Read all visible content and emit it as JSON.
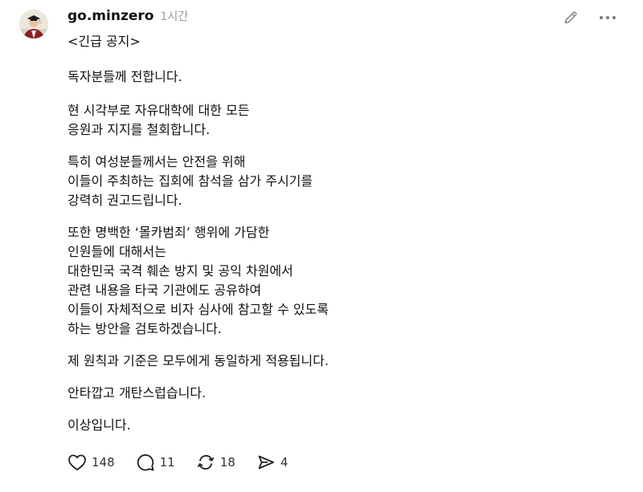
{
  "post": {
    "username": "go.minzero",
    "timestamp": "1시간",
    "paragraphs": [
      "<긴급 공지>",
      "독자분들께 전합니다.",
      "현 시각부로 자유대학에 대한 모든\n응원과 지지를 철회합니다.",
      "특히 여성분들께서는 안전을 위해\n이들이 주최하는 집회에 참석을 삼가 주시기를\n강력히 권고드립니다.",
      "또한 명백한 ‘몰카범죄’ 행위에 가담한\n인원들에 대해서는\n대한민국 국격 훼손 방지 및 공익 차원에서\n관련 내용을 타국 기관에도 공유하여\n이들이 자체적으로 비자 심사에 참고할 수 있도록\n하는 방안을 검토하겠습니다.",
      "제 원칙과 기준은 모두에게 동일하게 적용됩니다.",
      "안타깝고 개탄스럽습니다.",
      "이상입니다."
    ]
  },
  "actions": {
    "likes": "148",
    "comments": "11",
    "reposts": "18",
    "shares": "4"
  },
  "icons": {
    "edit": "pencil-icon",
    "more": "more-options-icon",
    "like": "heart-icon",
    "comment": "comment-bubble-icon",
    "repost": "repost-arrows-icon",
    "share": "send-arrow-icon"
  }
}
